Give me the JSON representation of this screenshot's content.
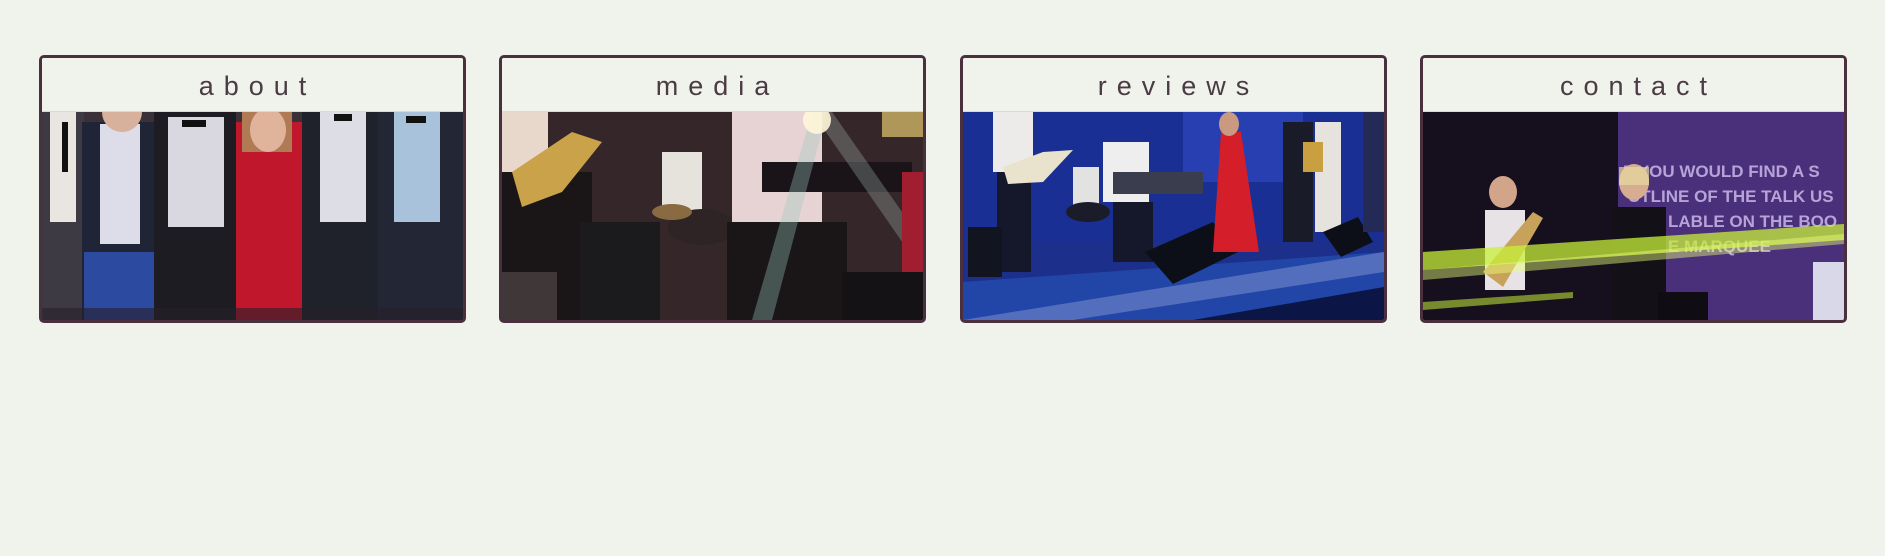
{
  "nav": {
    "cards": [
      {
        "label": "about",
        "photo": "band-group-photo"
      },
      {
        "label": "media",
        "photo": "band-performing-stage-lights"
      },
      {
        "label": "reviews",
        "photo": "band-on-blue-stage"
      },
      {
        "label": "contact",
        "photo": "singer-guitarist-purple-stage"
      }
    ]
  },
  "photo_text": {
    "contact": [
      "F YOU WOULD FIND A S",
      "UTLINE OF THE TALK US",
      "LABLE ON THE BOO",
      "E MARQUEE"
    ]
  },
  "colors": {
    "page_background": "#f0f2ec",
    "card_border": "#4a2f3f",
    "label_text": "#4a3b44"
  }
}
